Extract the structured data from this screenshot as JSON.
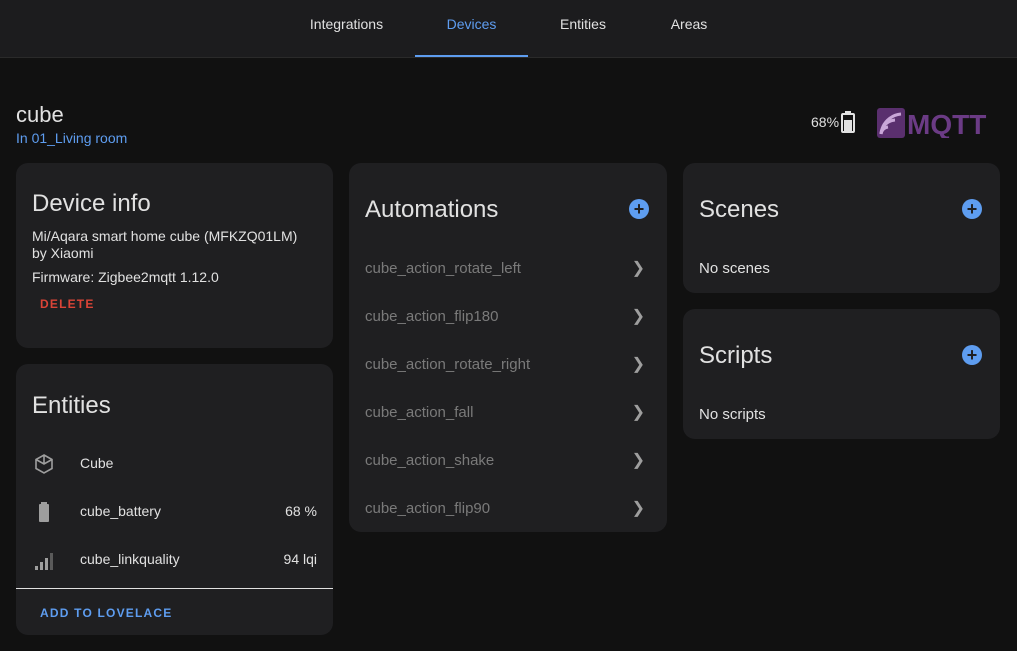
{
  "tabs": [
    {
      "label": "Integrations",
      "active": false
    },
    {
      "label": "Devices",
      "active": true
    },
    {
      "label": "Entities",
      "active": false
    },
    {
      "label": "Areas",
      "active": false
    }
  ],
  "device": {
    "title": "cube",
    "area": "In 01_Living room",
    "battery": "68%",
    "logo_text": "MQTT"
  },
  "device_info": {
    "title": "Device info",
    "model_line1": "Mi/Aqara smart home cube (MFKZQ01LM)",
    "model_line2": "by Xiaomi",
    "firmware": "Firmware: Zigbee2mqtt 1.12.0",
    "delete_label": "DELETE"
  },
  "entities": {
    "title": "Entities",
    "items": [
      {
        "icon": "cube-icon",
        "name": "Cube",
        "value": ""
      },
      {
        "icon": "battery-icon",
        "name": "cube_battery",
        "value": "68 %"
      },
      {
        "icon": "signal-icon",
        "name": "cube_linkquality",
        "value": "94 lqi"
      }
    ],
    "add_label": "ADD TO LOVELACE"
  },
  "automations": {
    "title": "Automations",
    "items": [
      "cube_action_rotate_left",
      "cube_action_flip180",
      "cube_action_rotate_right",
      "cube_action_fall",
      "cube_action_shake",
      "cube_action_flip90"
    ]
  },
  "scenes": {
    "title": "Scenes",
    "empty": "No scenes"
  },
  "scripts": {
    "title": "Scripts",
    "empty": "No scripts"
  },
  "colors": {
    "accent": "#5e9df0",
    "danger": "#db4437",
    "card": "#1f1f21",
    "background": "#111111"
  }
}
